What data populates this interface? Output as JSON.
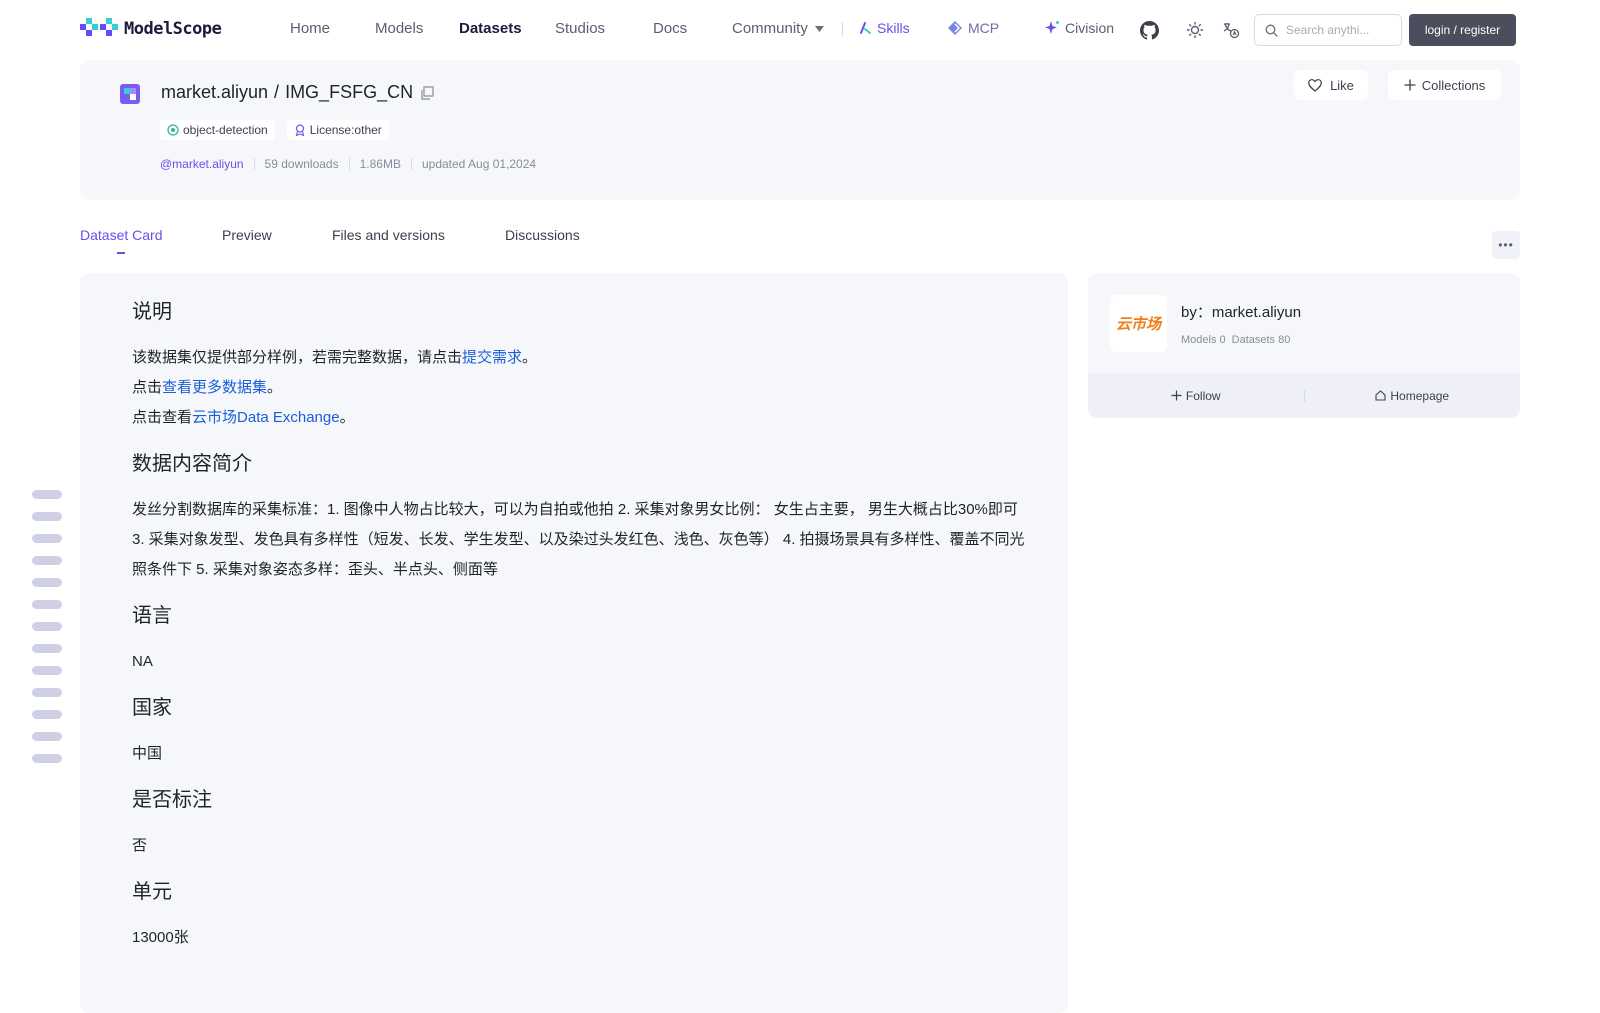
{
  "brand": {
    "name": "ModelScope"
  },
  "nav": {
    "home": "Home",
    "models": "Models",
    "datasets": "Datasets",
    "studios": "Studios",
    "docs": "Docs",
    "community": "Community",
    "skills": "Skills",
    "mcp": "MCP",
    "civision": "Civision"
  },
  "search": {
    "placeholder": "Search anythi..."
  },
  "auth": {
    "login_label": "login / register"
  },
  "dataset": {
    "owner_path": "market.aliyun",
    "separator": "/",
    "name": "IMG_FSFG_CN",
    "tags": [
      {
        "label": "object-detection",
        "icon": "target-icon"
      },
      {
        "label": "License:other",
        "icon": "award-icon"
      }
    ],
    "owner_handle": "@market.aliyun",
    "downloads": "59 downloads",
    "size": "1.86MB",
    "updated": "updated Aug 01,2024"
  },
  "actions": {
    "like": "Like",
    "collections": "Collections"
  },
  "tabs": [
    {
      "label": "Dataset Card",
      "active": true
    },
    {
      "label": "Preview",
      "active": false
    },
    {
      "label": "Files and versions",
      "active": false
    },
    {
      "label": "Discussions",
      "active": false
    }
  ],
  "card": {
    "s1_title": "说明",
    "s1_l1_pre": "该数据集仅提供部分样例，若需完整数据，请点击",
    "s1_l1_link": "提交需求",
    "s1_l1_post": "。",
    "s1_l2_pre": "点击",
    "s1_l2_link": "查看更多数据集",
    "s1_l2_post": "。",
    "s1_l3_pre": "点击查看",
    "s1_l3_link": "云市场Data Exchange",
    "s1_l3_post": "。",
    "s2_title": "数据内容简介",
    "s2_body": "发丝分割数据库的采集标准：1. 图像中人物占比较大，可以为自拍或他拍 2. 采集对象男女比例： 女生占主要， 男生大概占比30%即可 3. 采集对象发型、发色具有多样性（短发、长发、学生发型、以及染过头发红色、浅色、灰色等） 4. 拍摄场景具有多样性、覆盖不同光照条件下 5. 采集对象姿态多样：歪头、半点头、侧面等",
    "s3_title": "语言",
    "s3_body": "NA",
    "s4_title": "国家",
    "s4_body": "中国",
    "s5_title": "是否标注",
    "s5_body": "否",
    "s6_title": "单元",
    "s6_body": "13000张"
  },
  "publisher": {
    "logo_text": "云市场",
    "name": "by：market.aliyun",
    "models": "Models 0",
    "datasets": "Datasets 80",
    "follow": "Follow",
    "homepage": "Homepage"
  },
  "colors": {
    "accent": "#6c4ee8",
    "link": "#1a5ed8",
    "card_bg": "#f6f7fb",
    "publisher_logo": "#f07d18"
  }
}
